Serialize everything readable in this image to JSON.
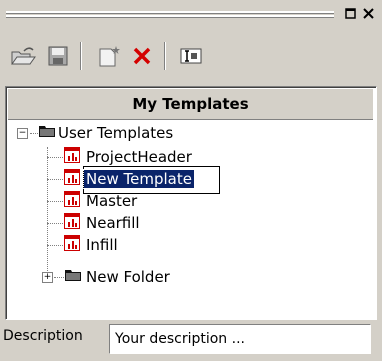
{
  "panel": {
    "header": "My Templates",
    "tree": {
      "root": "User Templates",
      "templates": [
        "ProjectHeader",
        "New Template",
        "Master",
        "Nearfill",
        "Infill"
      ],
      "folder": "New Folder"
    }
  },
  "description": {
    "label": "Description",
    "value": "Your description ..."
  },
  "icons": {
    "open": "open-folder-icon",
    "save": "save-icon",
    "new": "new-template-icon",
    "delete": "delete-icon",
    "rename": "rename-icon",
    "restore": "restore-icon",
    "close": "close-icon"
  },
  "colors": {
    "selection": "#0a246a",
    "delete_red": "#d40000",
    "chrome": "#d4d0c8"
  }
}
